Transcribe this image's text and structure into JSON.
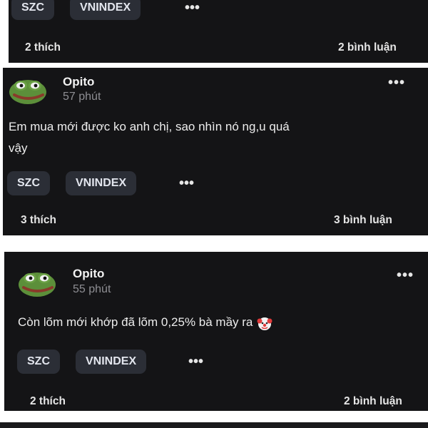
{
  "posts": [
    {
      "tags": [
        "SZC",
        "VNINDEX"
      ],
      "more_label": "•••",
      "likes": "2 thích",
      "comments": "2 bình luận"
    },
    {
      "author": "Opito",
      "time": "57 phút",
      "menu_label": "•••",
      "content_line1": "Em mua mới được ko anh chị, sao nhìn nó ng,u quá",
      "content_line2": "vậy",
      "tags": [
        "SZC",
        "VNINDEX"
      ],
      "more_label": "•••",
      "likes": "3 thích",
      "comments": "3 bình luận"
    },
    {
      "author": "Opito",
      "time": "55 phút",
      "menu_label": "•••",
      "content": "Còn lõm mới khớp đã lõm 0,25% bà mầy ra",
      "content_emoji": "clown-face-icon",
      "tags": [
        "SZC",
        "VNINDEX"
      ],
      "more_label": "•••",
      "likes": "2 thích",
      "comments": "2 bình luận"
    }
  ],
  "colors": {
    "card_bg": "#141416",
    "chip_bg": "#2b2e36",
    "time_text": "#8e8e93",
    "page_bg": "#ffffff"
  }
}
